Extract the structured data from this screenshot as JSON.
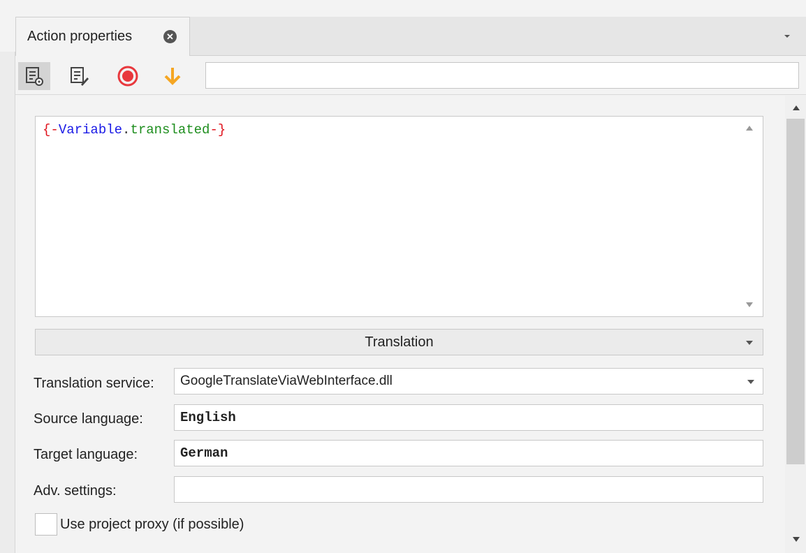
{
  "tab": {
    "label": "Action properties",
    "close_icon": "close-circle-icon"
  },
  "toolbar": {
    "buttons": [
      {
        "icon": "properties-gear-icon"
      },
      {
        "icon": "edit-list-icon"
      },
      {
        "icon": "record-icon",
        "color": "#e8383d"
      },
      {
        "icon": "arrow-down-icon",
        "color": "#f5a623"
      }
    ],
    "search_value": ""
  },
  "editor": {
    "brace_open": "{-",
    "variable": "Variable",
    "dot": ".",
    "name": "translated",
    "brace_close": "-}"
  },
  "section": {
    "title": "Translation"
  },
  "fields": {
    "service_label": "Translation service:",
    "service_value": "GoogleTranslateViaWebInterface.dll",
    "source_label": "Source language:",
    "source_value": "English",
    "target_label": "Target language:",
    "target_value": "German",
    "adv_label": "Adv. settings:",
    "adv_value": ""
  },
  "proxy": {
    "label": "Use project proxy (if possible)",
    "checked": false
  }
}
